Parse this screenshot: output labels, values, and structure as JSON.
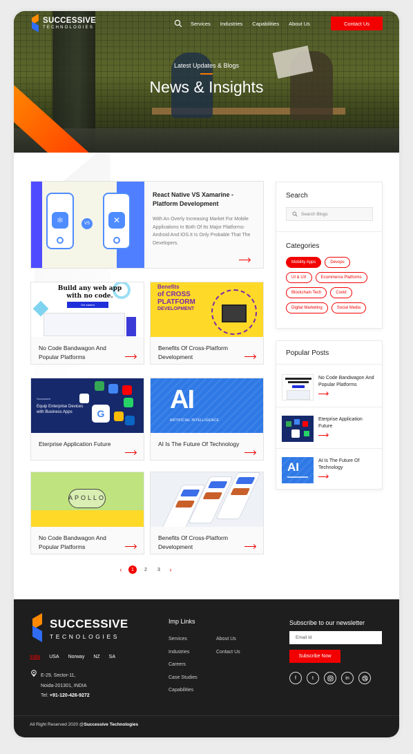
{
  "header": {
    "logo": {
      "line1": "SUCCESSIVE",
      "line2": "TECHNOLOGIES"
    },
    "nav": [
      "Services",
      "Industries",
      "Capabilities",
      "About Us"
    ],
    "contact_label": "Contact Us"
  },
  "hero": {
    "subtitle": "Latest Updates & Blogs",
    "title": "News & Insights"
  },
  "featured": {
    "title": "React Native VS Xamarine - Platform Development",
    "description": "With An Overly Increasing Market For Mobile Applications In Both Of Its Major Platforms- Android And IOS.It Is Only Probable That The Developers."
  },
  "cards": [
    {
      "title": "No Code Bandwagon And Popular Platforms",
      "thumb_text": "Build any web app with no code.",
      "thumb_button": "Get started"
    },
    {
      "title": "Benefits Of Cross-Platform Development",
      "thumb_line1": "Benefits",
      "thumb_line2": "of CROSS PLATFORM",
      "thumb_line3": "DEVELOPMENT"
    },
    {
      "title": "Eterprise Application Future",
      "thumb_brand": "Successive",
      "thumb_text": "Equip Enterprise Devices with Business Apps"
    },
    {
      "title": "AI Is The Future Of Technology",
      "thumb_big": "AI",
      "thumb_label": "ARTIFICIAL INTELLIGENCE"
    },
    {
      "title": "No Code Bandwagon And Popular Platforms",
      "thumb_word": "APOLLO"
    },
    {
      "title": "Benefits Of Cross-Platform Development"
    }
  ],
  "pagination": {
    "prev": "‹",
    "pages": [
      "1",
      "2",
      "3"
    ],
    "next": "›",
    "current": "1"
  },
  "sidebar": {
    "search_title": "Search",
    "search_placeholder": "Search Blogs",
    "categories_title": "Categories",
    "categories": [
      "Mobility Apps",
      "Devops",
      "UI & UX",
      "Ecommerce Platforms",
      "Blockchain Tech",
      "Covid",
      "Digital Marketing",
      "Social Media"
    ],
    "active_category": "Mobility Apps",
    "popular_title": "Popular Posts",
    "popular": [
      {
        "title": "No Code Bandwagon And Popular Platforms"
      },
      {
        "title": "Eterprise Application Future"
      },
      {
        "title": "AI Is The Future Of Technology"
      }
    ]
  },
  "footer": {
    "logo": {
      "line1": "SUCCESSIVE",
      "line2": "TECNOLOGIES"
    },
    "countries": [
      "India",
      "USA",
      "Norway",
      "NZ",
      "SA"
    ],
    "active_country": "India",
    "address": {
      "line1": "E-29, Sector-11,",
      "line2": "Noida-201301, INDIA",
      "tel_label": "Tel:",
      "tel": "+91-120-426-9272"
    },
    "imp_links_title": "Imp Links",
    "links_col1": [
      "Services",
      "Industries",
      "Careers",
      "Case Studies",
      "Capabilities"
    ],
    "links_col2": [
      "About Us",
      "Contact Us"
    ],
    "newsletter_title": "Subscribe to our newsletter",
    "email_placeholder": "Email Id",
    "subscribe_label": "Subscribe Now",
    "socials": [
      "facebook-icon",
      "twitter-icon",
      "instagram-icon",
      "linkedin-icon",
      "dribbble-icon"
    ],
    "copyright_prefix": "All Right Reserved 2020 @",
    "copyright_brand": "Successive Technologies"
  },
  "colors": {
    "accent": "#f20000",
    "orange": "#ff7a00",
    "footer_bg": "#1e1e1e"
  }
}
